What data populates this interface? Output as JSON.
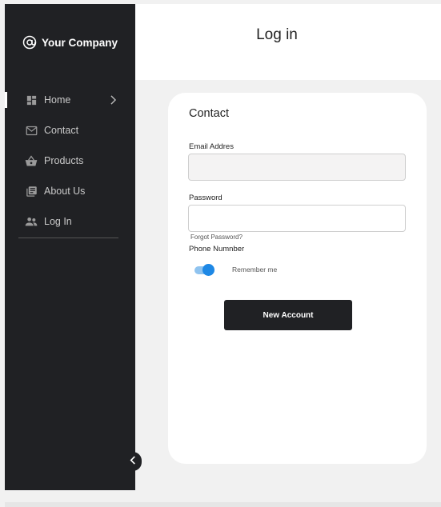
{
  "brand": {
    "name": "Your Company",
    "icon": "at-icon"
  },
  "sidebar": {
    "items": [
      {
        "label": "Home",
        "icon": "dashboard-icon",
        "active": true,
        "has_chevron": true
      },
      {
        "label": "Contact",
        "icon": "mail-icon"
      },
      {
        "label": "Products",
        "icon": "basket-icon"
      },
      {
        "label": "About Us",
        "icon": "library-books-icon"
      },
      {
        "label": "Log In",
        "icon": "people-icon"
      }
    ],
    "collapse_icon": "chevron-left-icon"
  },
  "header": {
    "title": "Log in"
  },
  "form": {
    "title": "Contact",
    "email_label": "Email Addres",
    "email_value": "",
    "password_label": "Password",
    "password_value": "",
    "forgot_label": "Forgot Password?",
    "phone_label": "Phone Numnber",
    "remember_label": "Remember me",
    "remember_on": true,
    "submit_label": "New Account"
  },
  "colors": {
    "sidebar_bg": "#202124",
    "page_bg": "#f1f1f1",
    "toggle_accent": "#1e88e5",
    "button_bg": "#202124"
  }
}
